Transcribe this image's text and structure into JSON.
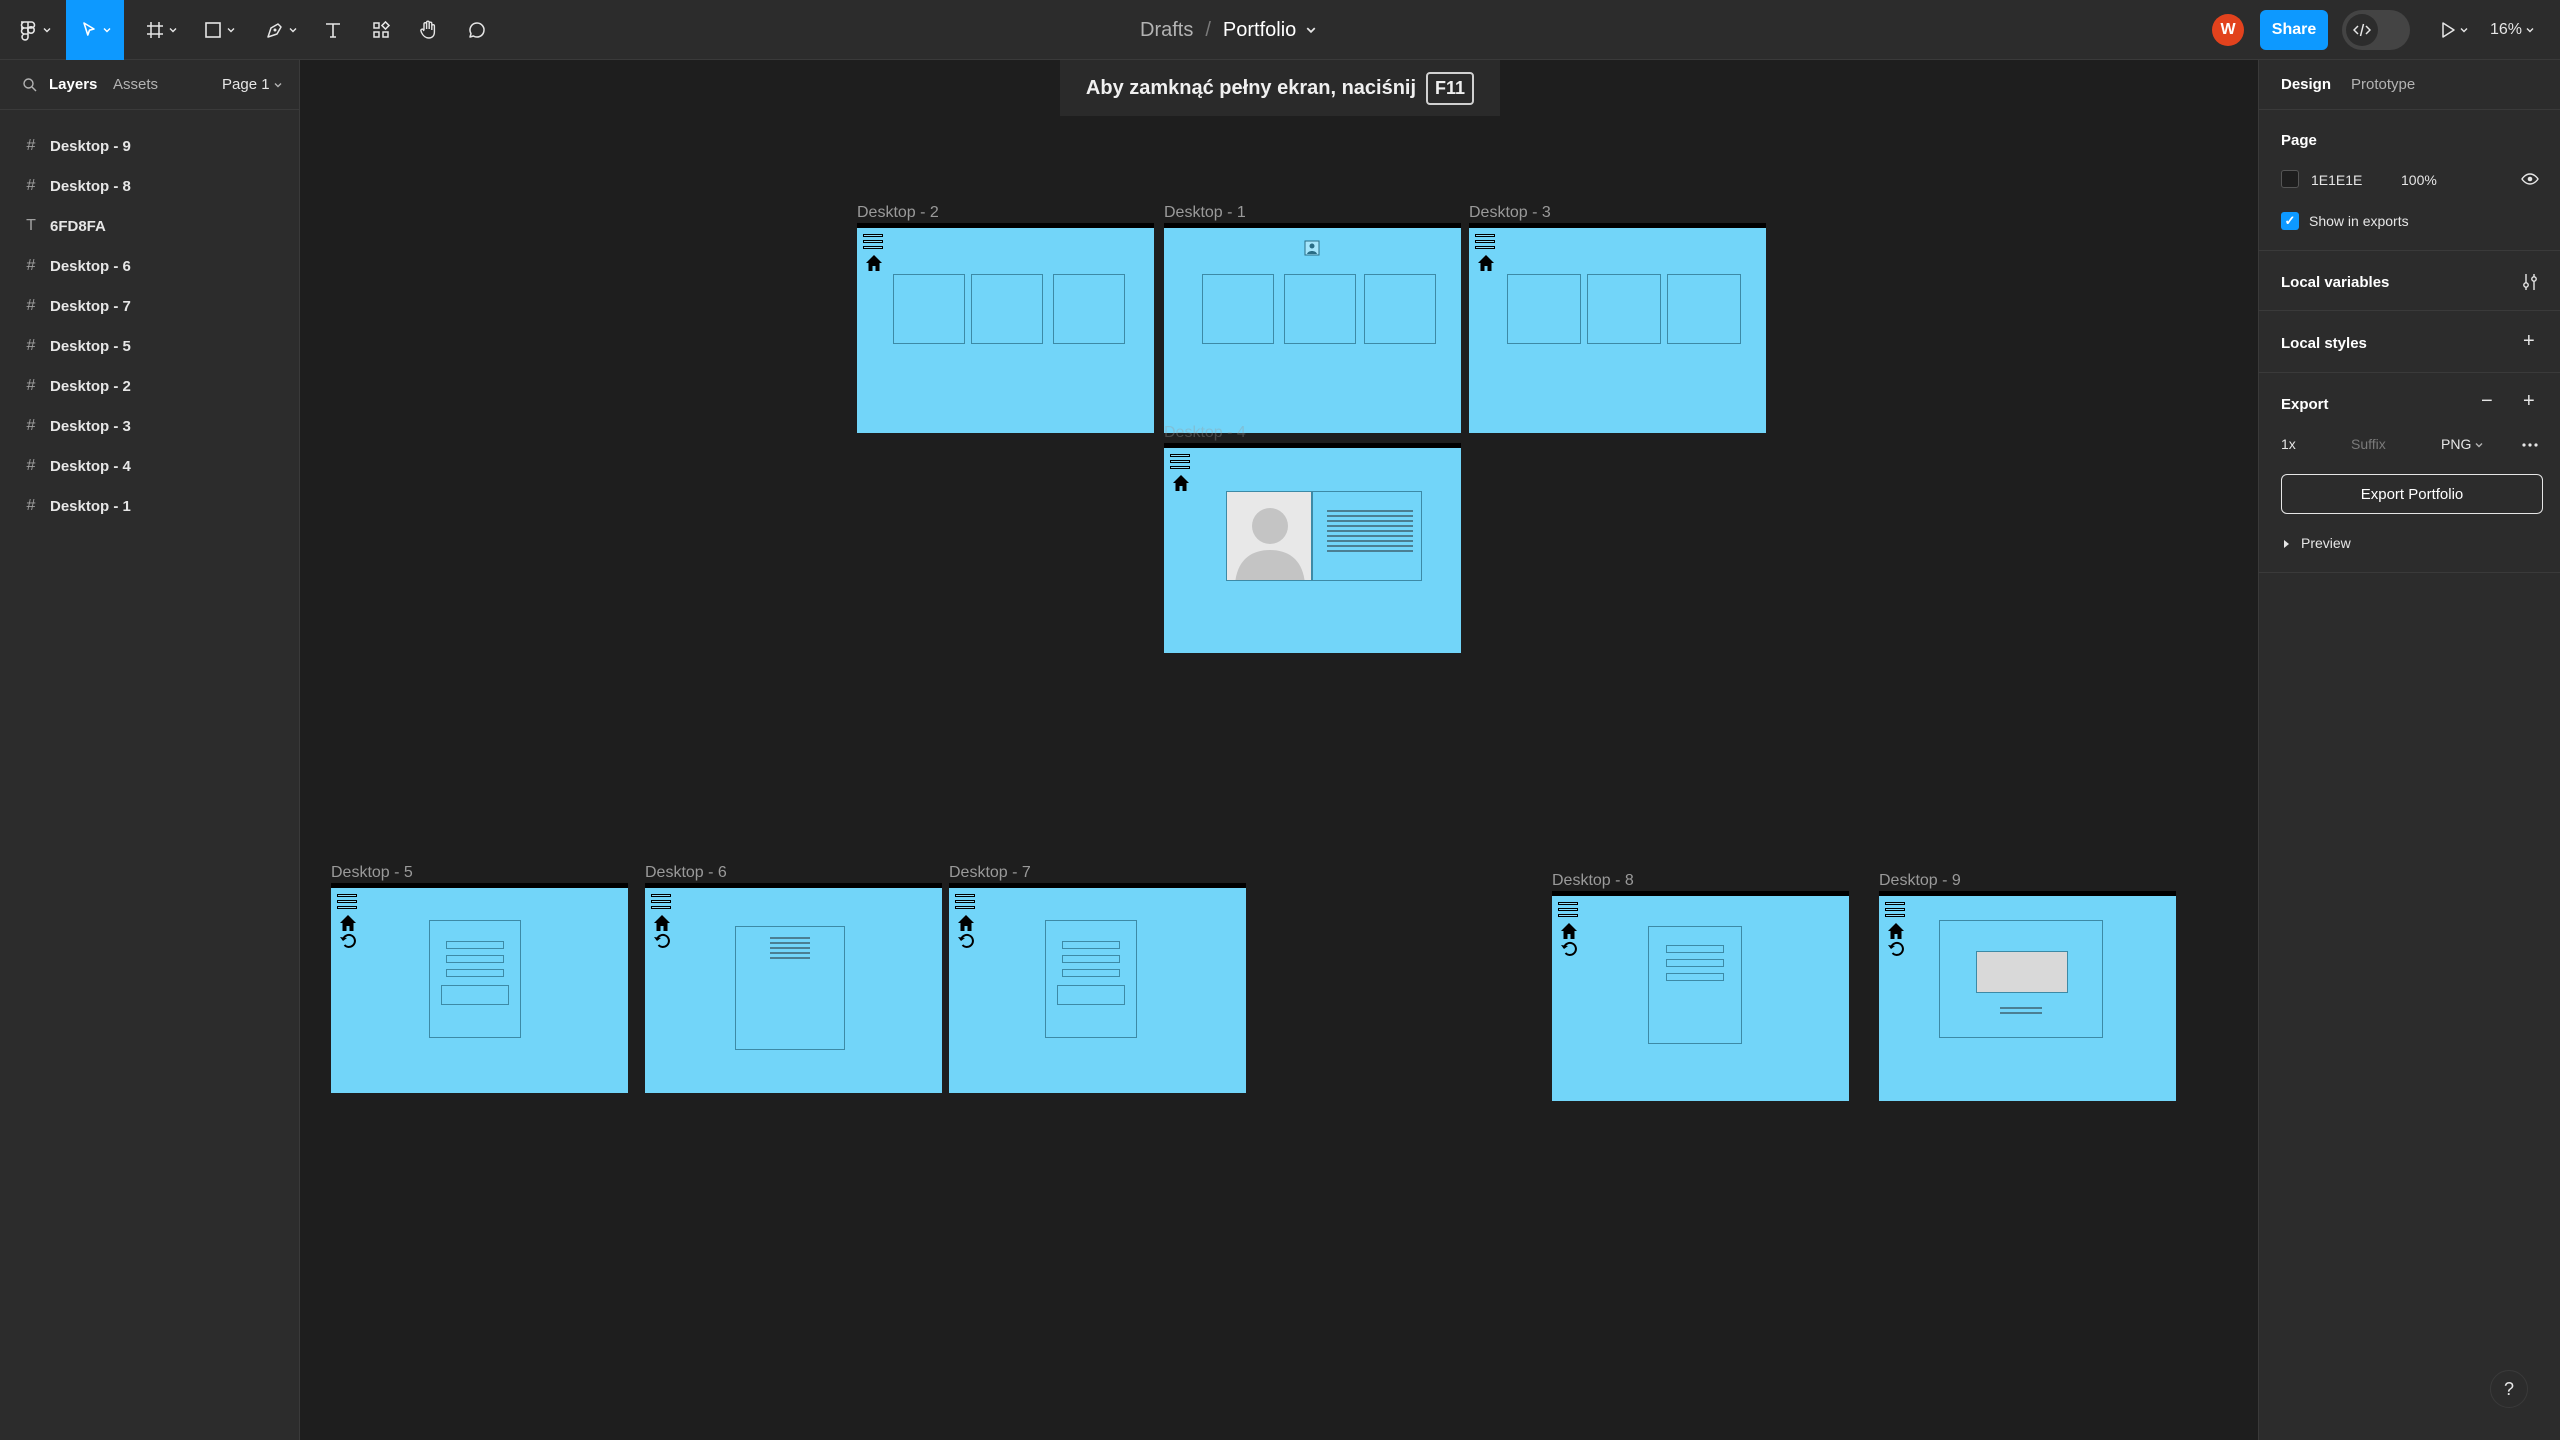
{
  "toolbar": {
    "breadcrumb_project": "Drafts",
    "breadcrumb_separator": "/",
    "file_name": "Portfolio",
    "avatar_initial": "W",
    "share_label": "Share",
    "zoom_level": "16%",
    "tools": [
      "main-menu",
      "move",
      "frame",
      "shape",
      "pen",
      "text",
      "resources",
      "hand",
      "comment"
    ]
  },
  "fullscreen_banner": {
    "text": "Aby zamknąć pełny ekran, naciśnij",
    "key": "F11"
  },
  "left_panel": {
    "tabs": [
      "Layers",
      "Assets"
    ],
    "active_tab": "Layers",
    "page_selector": "Page 1",
    "layers": [
      {
        "type": "frame",
        "name": "Desktop - 9"
      },
      {
        "type": "frame",
        "name": "Desktop - 8"
      },
      {
        "type": "text",
        "name": "6FD8FA"
      },
      {
        "type": "frame",
        "name": "Desktop - 6"
      },
      {
        "type": "frame",
        "name": "Desktop - 7"
      },
      {
        "type": "frame",
        "name": "Desktop - 5"
      },
      {
        "type": "frame",
        "name": "Desktop - 2"
      },
      {
        "type": "frame",
        "name": "Desktop - 3"
      },
      {
        "type": "frame",
        "name": "Desktop - 4"
      },
      {
        "type": "frame",
        "name": "Desktop - 1"
      }
    ]
  },
  "right_panel": {
    "tabs": [
      "Design",
      "Prototype"
    ],
    "active_tab": "Design",
    "page_section": {
      "title": "Page",
      "background_color": "1E1E1E",
      "opacity": "100%",
      "show_in_exports_label": "Show in exports",
      "show_in_exports": true
    },
    "local_variables_label": "Local variables",
    "local_styles_label": "Local styles",
    "export": {
      "title": "Export",
      "scale": "1x",
      "suffix_placeholder": "Suffix",
      "format": "PNG",
      "button_label": "Export Portfolio",
      "preview_label": "Preview"
    },
    "help_label": "?"
  },
  "canvas": {
    "background": "#1e1e1e",
    "frame_fill": "#72d5f9",
    "frames": {
      "d1": "Desktop - 1",
      "d2": "Desktop - 2",
      "d3": "Desktop - 3",
      "d4": "Desktop - 4",
      "d5": "Desktop - 5",
      "d6": "Desktop - 6",
      "d7": "Desktop - 7",
      "d8": "Desktop - 8",
      "d9": "Desktop - 9"
    }
  },
  "colors": {
    "accent": "#0d99ff",
    "avatar": "#e2421d",
    "panel": "#2c2c2c"
  }
}
